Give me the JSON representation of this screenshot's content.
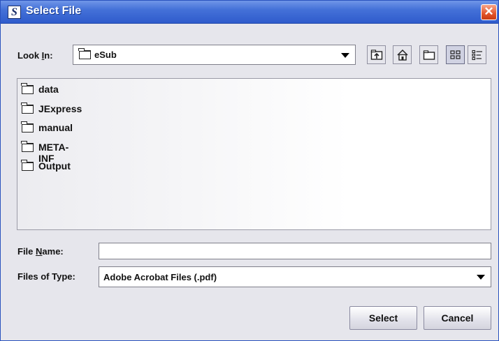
{
  "window": {
    "title": "Select File",
    "app_icon_letter": "S",
    "close_glyph": "✕"
  },
  "lookin": {
    "label_prefix": "Look ",
    "label_mnemonic": "I",
    "label_suffix": "n:",
    "current": "eSub"
  },
  "toolbar": {
    "up_icon": "up-folder-icon",
    "home_icon": "home-icon",
    "new_folder_icon": "new-folder-icon",
    "list_icon": "list-view-icon",
    "details_icon": "details-view-icon"
  },
  "files": [
    {
      "name": "data"
    },
    {
      "name": "JExpress"
    },
    {
      "name": "manual"
    },
    {
      "name": "META-INF"
    },
    {
      "name": "Output"
    }
  ],
  "filename": {
    "label_prefix": "File ",
    "label_mnemonic": "N",
    "label_suffix": "ame:",
    "value": ""
  },
  "filetype": {
    "label": "Files of Type:",
    "selected": "Adobe Acrobat Files (.pdf)"
  },
  "buttons": {
    "select": "Select",
    "cancel": "Cancel"
  },
  "colors": {
    "title_bar": "#3d67d2",
    "close": "#e2542b",
    "panel": "#e6e6ec"
  }
}
